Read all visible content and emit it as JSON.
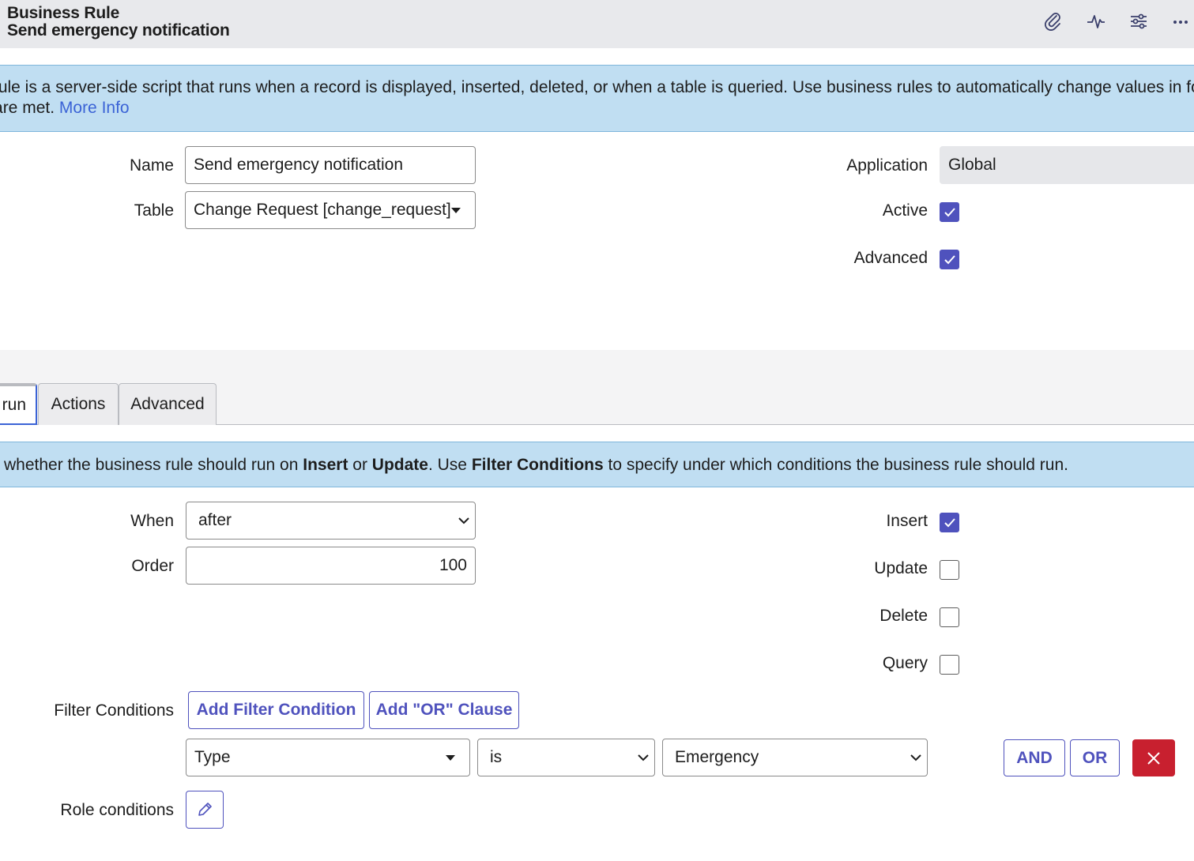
{
  "header": {
    "type_label": "Business Rule",
    "record_name": "Send emergency notification",
    "icons": [
      "paperclip-icon",
      "activity-pulse-icon",
      "sliders-icon",
      "more-icon"
    ]
  },
  "info_banner": {
    "line1": "ss rule is a server-side script that runs when a record is displayed, inserted, deleted, or when a table is queried. Use business rules to automatically change values in form",
    "line2_prefix": "ns are met. ",
    "link": "More Info"
  },
  "form": {
    "name_label": "Name",
    "name_value": "Send emergency notification",
    "table_label": "Table",
    "table_value": "Change Request [change_request]",
    "application_label": "Application",
    "application_value": "Global",
    "active_label": "Active",
    "active_checked": true,
    "advanced_label": "Advanced",
    "advanced_checked": true
  },
  "tabs": [
    {
      "label": "run",
      "active": true
    },
    {
      "label": "Actions",
      "active": false
    },
    {
      "label": "Advanced",
      "active": false
    }
  ],
  "when_banner": {
    "t1": " whether the business rule should run on ",
    "b1": "Insert",
    "t2": " or ",
    "b2": "Update",
    "t3": ". Use ",
    "b3": "Filter Conditions",
    "t4": " to specify under which conditions the business rule should run."
  },
  "when_section": {
    "when_label": "When",
    "when_value": "after",
    "order_label": "Order",
    "order_value": "100",
    "insert_label": "Insert",
    "insert_checked": true,
    "update_label": "Update",
    "update_checked": false,
    "delete_label": "Delete",
    "delete_checked": false,
    "query_label": "Query",
    "query_checked": false
  },
  "filter": {
    "label": "Filter Conditions",
    "add_condition": "Add Filter Condition",
    "add_or": "Add \"OR\" Clause",
    "field_value": "Type",
    "operator_value": "is",
    "value_value": "Emergency",
    "and_label": "AND",
    "or_label": "OR"
  },
  "role": {
    "label": "Role conditions"
  },
  "colors": {
    "accent": "#4f52bd",
    "banner_bg": "#c0def2",
    "link": "#3b63d6",
    "danger": "#c8202f",
    "header_bg": "#e8e9ec"
  }
}
